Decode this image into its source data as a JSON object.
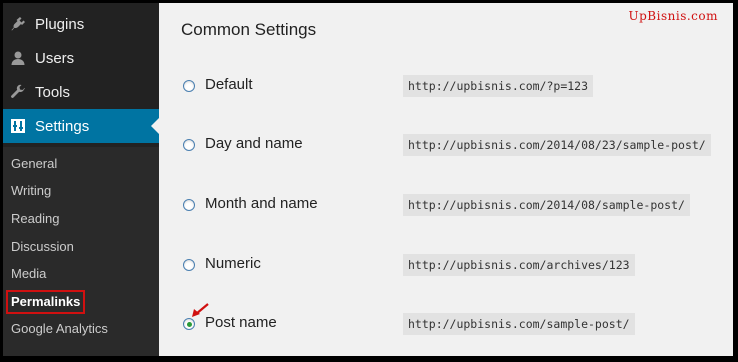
{
  "sidebar": {
    "menu": [
      {
        "label": "Plugins",
        "icon": "plugin-icon"
      },
      {
        "label": "Users",
        "icon": "user-icon"
      },
      {
        "label": "Tools",
        "icon": "wrench-icon"
      },
      {
        "label": "Settings",
        "icon": "settings-icon"
      }
    ],
    "submenu": [
      "General",
      "Writing",
      "Reading",
      "Discussion",
      "Media",
      "Permalinks",
      "Google Analytics"
    ]
  },
  "main": {
    "title": "Common Settings",
    "brand": "UpBisnis.com",
    "options": [
      {
        "label": "Default",
        "code": "http://upbisnis.com/?p=123",
        "checked": false
      },
      {
        "label": "Day and name",
        "code": "http://upbisnis.com/2014/08/23/sample-post/",
        "checked": false
      },
      {
        "label": "Month and name",
        "code": "http://upbisnis.com/2014/08/sample-post/",
        "checked": false
      },
      {
        "label": "Numeric",
        "code": "http://upbisnis.com/archives/123",
        "checked": false
      },
      {
        "label": "Post name",
        "code": "http://upbisnis.com/sample-post/",
        "checked": true
      }
    ]
  },
  "colors": {
    "accent": "#0074a2",
    "highlight": "#d01010"
  }
}
